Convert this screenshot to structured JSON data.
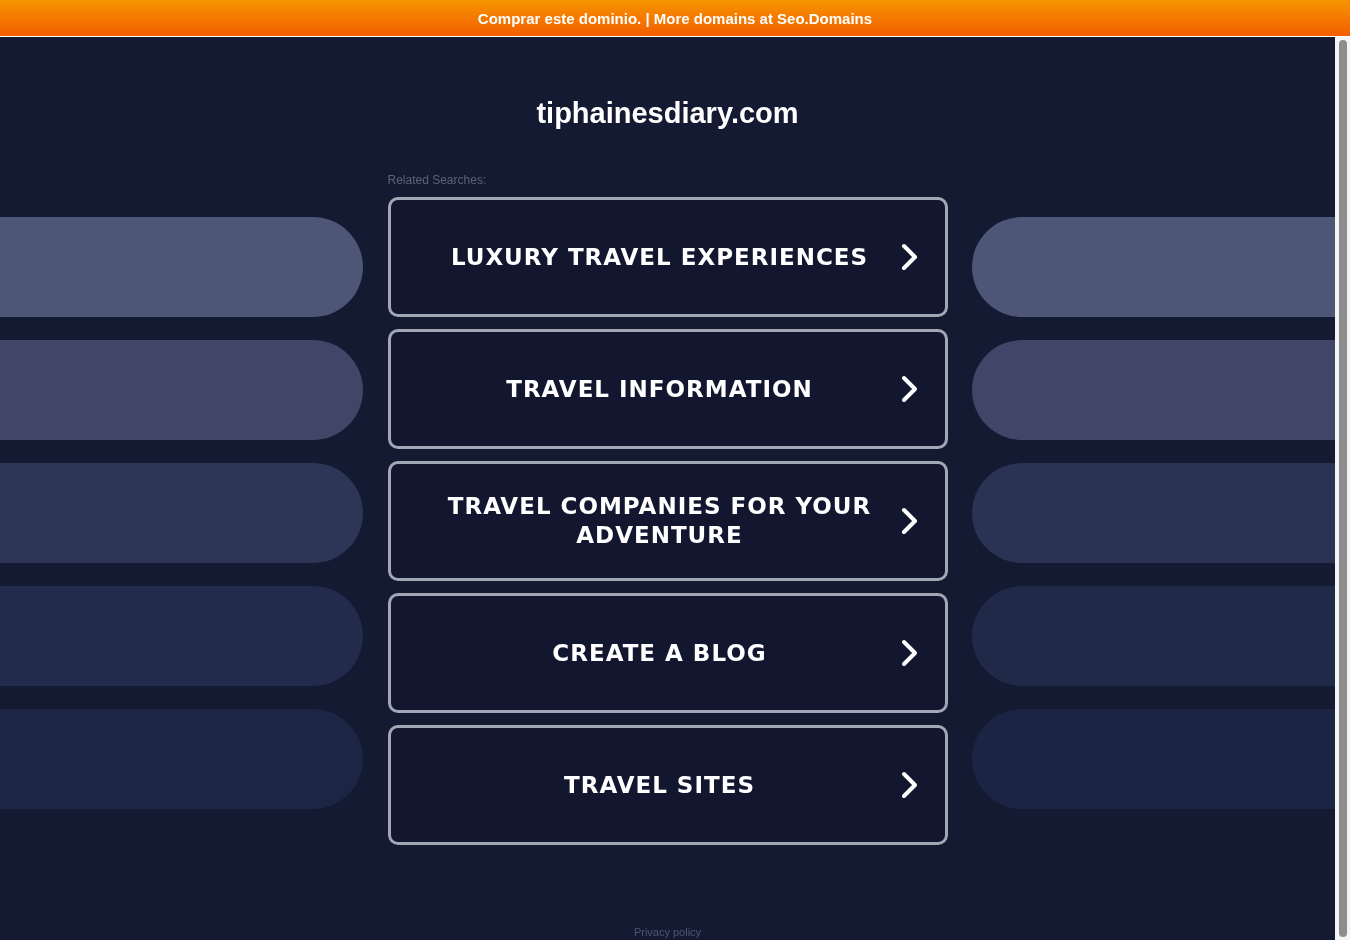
{
  "top_banner": {
    "text": "Comprar este dominio. | More domains at Seo.Domains"
  },
  "domain_title": "tiphainesdiary.com",
  "related_searches": {
    "label": "Related Searches:",
    "items": [
      {
        "label": "LUXURY TRAVEL EXPERIENCES"
      },
      {
        "label": "TRAVEL INFORMATION"
      },
      {
        "label": "TRAVEL COMPANIES FOR YOUR ADVENTURE"
      },
      {
        "label": "CREATE A BLOG"
      },
      {
        "label": "TRAVEL SITES"
      }
    ]
  },
  "footer": {
    "privacy_link": "Privacy policy"
  }
}
